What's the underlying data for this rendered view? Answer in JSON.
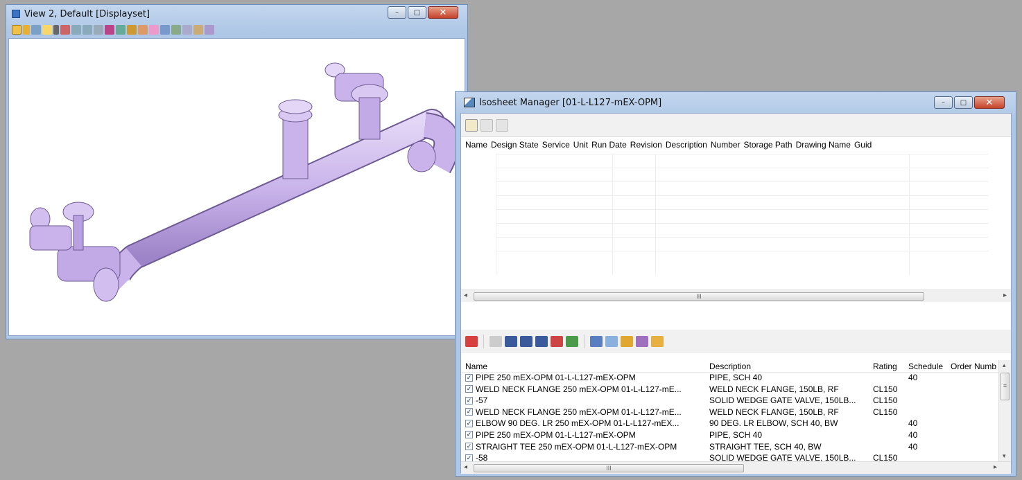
{
  "view_window": {
    "title": "View 2, Default [Displayset]",
    "minimize_glyph": "–",
    "restore_glyph": "□",
    "close_glyph": "✕",
    "model_color": "#c9b3ea"
  },
  "iso_window": {
    "title": "Isosheet Manager [01-L-L127-mEX-OPM]",
    "minimize_glyph": "–",
    "restore_glyph": "□",
    "close_glyph": "✕",
    "top_grid": {
      "columns": [
        "Name",
        "Design State",
        "Service",
        "Unit",
        "Run Date",
        "Revision",
        "Description",
        "Number",
        "Storage Path",
        "Drawing Name",
        "Guid"
      ],
      "scroll_marker": "III",
      "left_arrow": "◂",
      "right_arrow": "▸"
    },
    "bottom_table": {
      "columns": {
        "name": "Name",
        "description": "Description",
        "rating": "Rating",
        "schedule": "Schedule",
        "order": "Order Numb"
      },
      "scroll_marker": "III",
      "left_arrow": "◂",
      "right_arrow": "▸",
      "up_arrow": "▴",
      "down_arrow": "▾",
      "thumb_marker": "≡",
      "rows": [
        {
          "checked": "✓",
          "name": "PIPE 250 mEX-OPM 01-L-L127-mEX-OPM",
          "description": "PIPE, SCH 40",
          "rating": "",
          "schedule": "40",
          "order": ""
        },
        {
          "checked": "✓",
          "name": "WELD NECK FLANGE 250 mEX-OPM 01-L-L127-mE...",
          "description": "WELD NECK FLANGE, 150LB, RF",
          "rating": "CL150",
          "schedule": "",
          "order": ""
        },
        {
          "checked": "✓",
          "name": "-57",
          "description": "SOLID WEDGE GATE VALVE, 150LB...",
          "rating": "CL150",
          "schedule": "",
          "order": ""
        },
        {
          "checked": "✓",
          "name": "WELD NECK FLANGE 250 mEX-OPM 01-L-L127-mE...",
          "description": "WELD NECK FLANGE, 150LB, RF",
          "rating": "CL150",
          "schedule": "",
          "order": ""
        },
        {
          "checked": "✓",
          "name": "ELBOW 90 DEG. LR 250 mEX-OPM 01-L-L127-mEX...",
          "description": "90 DEG. LR ELBOW, SCH 40, BW",
          "rating": "",
          "schedule": "40",
          "order": ""
        },
        {
          "checked": "✓",
          "name": "PIPE 250 mEX-OPM 01-L-L127-mEX-OPM",
          "description": "PIPE, SCH 40",
          "rating": "",
          "schedule": "40",
          "order": ""
        },
        {
          "checked": "✓",
          "name": "STRAIGHT TEE 250 mEX-OPM 01-L-L127-mEX-OPM",
          "description": "STRAIGHT TEE, SCH 40, BW",
          "rating": "",
          "schedule": "40",
          "order": ""
        },
        {
          "checked": "✓",
          "name": "-58",
          "description": "SOLID WEDGE GATE VALVE, 150LB...",
          "rating": "CL150",
          "schedule": "",
          "order": ""
        }
      ]
    }
  }
}
